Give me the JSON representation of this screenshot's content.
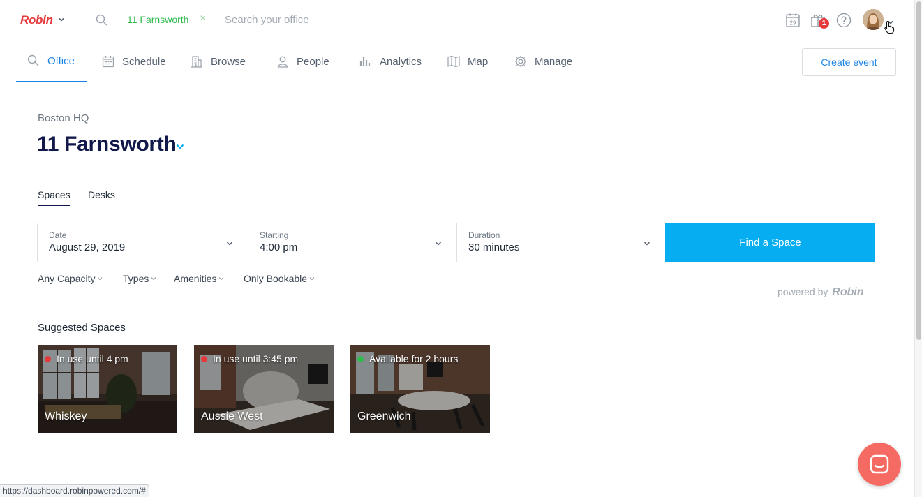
{
  "app": {
    "logo": "Robin"
  },
  "topbar": {
    "location_chip": "11 Farnsworth",
    "location_chip_remove": "×",
    "search_placeholder": "Search your office",
    "calendar_day": "29",
    "notification_count": "1"
  },
  "nav": {
    "items": [
      {
        "label": "Office",
        "icon": "search-icon",
        "active": true
      },
      {
        "label": "Schedule",
        "icon": "calendar-icon"
      },
      {
        "label": "Browse",
        "icon": "building-icon"
      },
      {
        "label": "People",
        "icon": "person-icon"
      },
      {
        "label": "Analytics",
        "icon": "bar-chart-icon"
      },
      {
        "label": "Map",
        "icon": "map-icon"
      },
      {
        "label": "Manage",
        "icon": "gear-icon"
      }
    ],
    "create_button": "Create event"
  },
  "main": {
    "organization": "Boston HQ",
    "building": "11 Farnsworth",
    "tabs": [
      {
        "label": "Spaces",
        "active": true
      },
      {
        "label": "Desks"
      }
    ],
    "search": {
      "date_label": "Date",
      "date_value": "August 29, 2019",
      "start_label": "Starting",
      "start_value": "4:00 pm",
      "duration_label": "Duration",
      "duration_value": "30 minutes",
      "find_button": "Find a Space"
    },
    "filters": [
      "Any Capacity",
      "Types",
      "Amenities",
      "Only Bookable"
    ],
    "powered_by": "powered by",
    "powered_brand": "Robin",
    "suggested_title": "Suggested Spaces",
    "spaces": [
      {
        "name": "Whiskey",
        "status": "In use until 4 pm",
        "status_color": "#e5393b"
      },
      {
        "name": "Aussie West",
        "status": "In use until 3:45 pm",
        "status_color": "#e5393b"
      },
      {
        "name": "Greenwich",
        "status": "Available for 2 hours",
        "status_color": "#2fba4d"
      }
    ]
  },
  "browser": {
    "status_url": "https://dashboard.robinpowered.com/#"
  },
  "colors": {
    "accent": "#1b84e4",
    "primary_button": "#06aef1",
    "brand_red": "#e5393b",
    "heading": "#11194a",
    "chat": "#f56b63"
  }
}
